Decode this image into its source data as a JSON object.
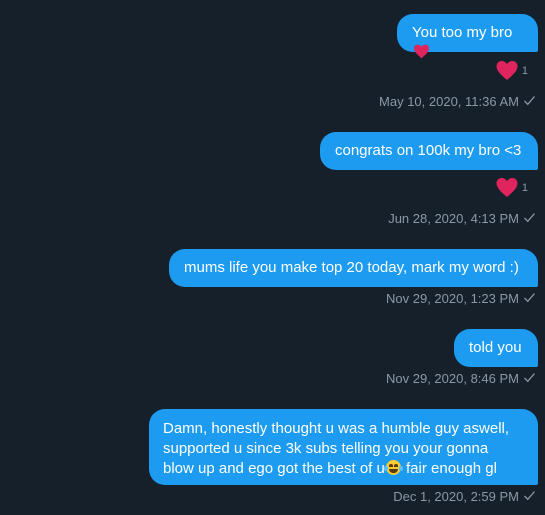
{
  "messages": [
    {
      "text": "You too my bro",
      "heart": true,
      "reaction_count": "1",
      "timestamp": "May 10, 2020, 11:36 AM"
    },
    {
      "text": "congrats on 100k my bro <3",
      "reaction_count": "1",
      "timestamp": "Jun 28, 2020, 4:13 PM"
    },
    {
      "text": "mums life you make top 20 today, mark my word :)",
      "timestamp": "Nov 29, 2020, 1:23 PM"
    },
    {
      "text": "told you",
      "timestamp": "Nov 29, 2020, 8:46 PM"
    },
    {
      "line1": "Damn, honestly thought u was a humble guy aswell,",
      "line2": "supported u since 3k subs telling you your gonna",
      "line3a": "blow up and ego got the best of u",
      "line3b": " fair enough gl",
      "timestamp": "Dec 1, 2020, 2:59 PM"
    }
  ],
  "icons": {
    "reaction": "red-heart-icon",
    "read_receipt": "checkmark-icon",
    "emoji": "tears-of-joy-emoji"
  },
  "colors": {
    "background": "#15202b",
    "bubble": "#1d9bf0",
    "heart": "#e0245e",
    "meta_text": "#8b98a5"
  }
}
